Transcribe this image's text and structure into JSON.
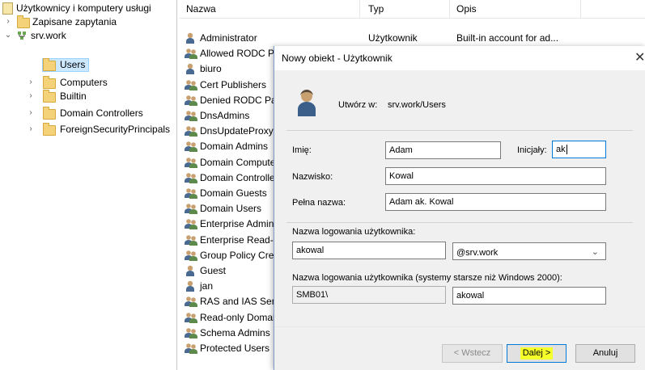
{
  "tree": {
    "root": "Użytkownicy i komputery usługi",
    "items": [
      {
        "label": "Zapisane zapytania"
      },
      {
        "label": "srv.work"
      },
      {
        "label": "Users"
      },
      {
        "label": "Computers"
      },
      {
        "label": "Builtin"
      },
      {
        "label": "Domain Controllers"
      },
      {
        "label": "ForeignSecurityPrincipals"
      }
    ]
  },
  "list": {
    "columns": [
      "Nazwa",
      "Typ",
      "Opis"
    ],
    "rows": [
      {
        "name": "Administrator",
        "type": "Użytkownik",
        "desc": "Built-in account for ad..."
      },
      {
        "name": "Allowed RODC Password Replication Group"
      },
      {
        "name": "biuro"
      },
      {
        "name": "Cert Publishers"
      },
      {
        "name": "Denied RODC Password Replication Group"
      },
      {
        "name": "DnsAdmins"
      },
      {
        "name": "DnsUpdateProxy"
      },
      {
        "name": "Domain Admins"
      },
      {
        "name": "Domain Computers"
      },
      {
        "name": "Domain Controllers"
      },
      {
        "name": "Domain Guests"
      },
      {
        "name": "Domain Users"
      },
      {
        "name": "Enterprise Admins"
      },
      {
        "name": "Enterprise Read-only Domain Controllers"
      },
      {
        "name": "Group Policy Creator Owners"
      },
      {
        "name": "Guest"
      },
      {
        "name": "jan"
      },
      {
        "name": "RAS and IAS Servers"
      },
      {
        "name": "Read-only Domain Controllers"
      },
      {
        "name": "Schema Admins"
      },
      {
        "name": "Protected Users"
      }
    ]
  },
  "dialog": {
    "title": "Nowy obiekt - Użytkownik",
    "close": "✕",
    "created_in_label": "Utwórz w:",
    "created_in_value": "srv.work/Users",
    "first_name_label": "Imię:",
    "first_name": "Adam",
    "initials_label": "Inicjały:",
    "initials": "ak",
    "last_name_label": "Nazwisko:",
    "last_name": "Kowal",
    "full_name_label": "Pełna nazwa:",
    "full_name": "Adam ak. Kowal",
    "logon_label": "Nazwa logowania użytkownika:",
    "logon_name": "akowal",
    "domain_suffix": "@srv.work",
    "legacy_label": "Nazwa logowania użytkownika (systemy starsze niż Windows 2000):",
    "legacy_domain": "SMB01\\",
    "legacy_name": "akowal",
    "back_label": "< Wstecz",
    "next_label": "Dalej >",
    "cancel_label": "Anuluj",
    "highlight_color": "#f5ff2a"
  }
}
